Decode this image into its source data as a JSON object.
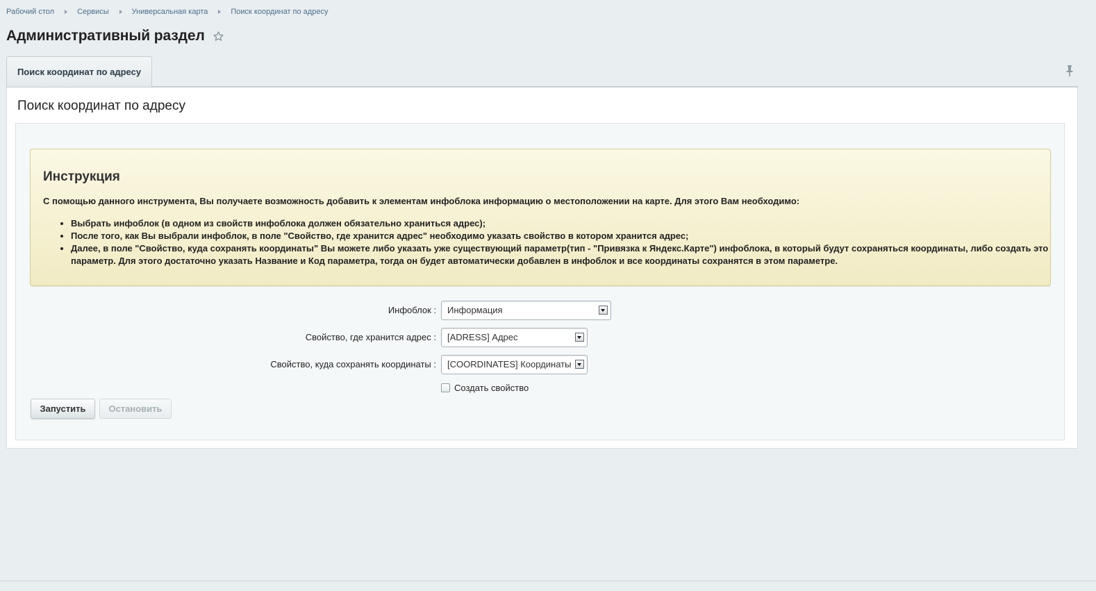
{
  "breadcrumb": {
    "items": [
      {
        "label": "Рабочий стол"
      },
      {
        "label": "Сервисы"
      },
      {
        "label": "Универсальная карта"
      },
      {
        "label": "Поиск координат по адресу"
      }
    ]
  },
  "header": {
    "title": "Административный раздел",
    "star_icon": "star-outline-icon"
  },
  "tabs": [
    {
      "label": "Поиск координат по адресу",
      "active": true
    }
  ],
  "toolbar": {
    "pin_icon": "pin-icon"
  },
  "main": {
    "heading": "Поиск координат по адресу",
    "notice": {
      "title": "Инструкция",
      "intro": "С помощью данного инструмента, Вы получаете возможность добавить к элементам инфоблока информацию о местоположении на карте. Для этого Вам необходимо:",
      "items": [
        "Выбрать инфоблок (в одном из свойств инфоблока должен обязательно храниться адрес);",
        "После того, как Вы выбрали инфоблок, в поле \"Свойство, где хранится адрес\" необходимо указать свойство в котором хранится адрес;",
        "Далее, в поле \"Свойство, куда сохранять координаты\" Вы можете либо указать уже существующий параметр(тип - \"Привязка к Яндекс.Карте\") инфоблока, в который будут сохраняться координаты, либо создать это параметр. Для этого достаточно указать Название и Код параметра, тогда он будет автоматически добавлен в инфоблок и все координаты сохранятся в этом параметре."
      ]
    },
    "form": {
      "iblock": {
        "label": "Инфоблок :",
        "value": "Информация"
      },
      "address_prop": {
        "label": "Свойство, где хранится адрес :",
        "value": "[ADRESS] Адрес"
      },
      "coords_prop": {
        "label": "Свойство, куда сохранять координаты :",
        "value": "[COORDINATES] Координаты"
      },
      "create_prop": {
        "label": "Создать свойство",
        "checked": false
      }
    },
    "buttons": {
      "start": "Запустить",
      "stop": "Остановить"
    }
  },
  "colors": {
    "background": "#e9eef1",
    "link": "#4b6d8a",
    "notice_bg": "#f4efcf",
    "notice_border": "#d7cf97"
  }
}
